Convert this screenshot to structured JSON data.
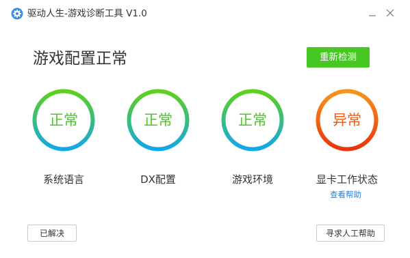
{
  "window": {
    "title": "驱动人生-游戏诊断工具 V1.0",
    "icon": "gear-icon",
    "controls": [
      "minimize-icon",
      "close-icon"
    ]
  },
  "main": {
    "heading": "游戏配置正常",
    "recheck_label": "重新检测"
  },
  "items": [
    {
      "label": "系统语言",
      "status": "正常",
      "state": "ok"
    },
    {
      "label": "DX配置",
      "status": "正常",
      "state": "ok"
    },
    {
      "label": "游戏环境",
      "status": "正常",
      "state": "ok"
    },
    {
      "label": "显卡工作状态",
      "status": "异常",
      "state": "error",
      "link": "查看帮助"
    }
  ],
  "footer": {
    "resolved_label": "已解决",
    "human_help_label": "寻求人工帮助"
  },
  "colors": {
    "accent_green": "#47c723",
    "ok_gradient": [
      "#5fd11a",
      "#13a8e8"
    ],
    "error_gradient": [
      "#f7941d",
      "#e8360f"
    ],
    "link": "#2e7fd6"
  }
}
